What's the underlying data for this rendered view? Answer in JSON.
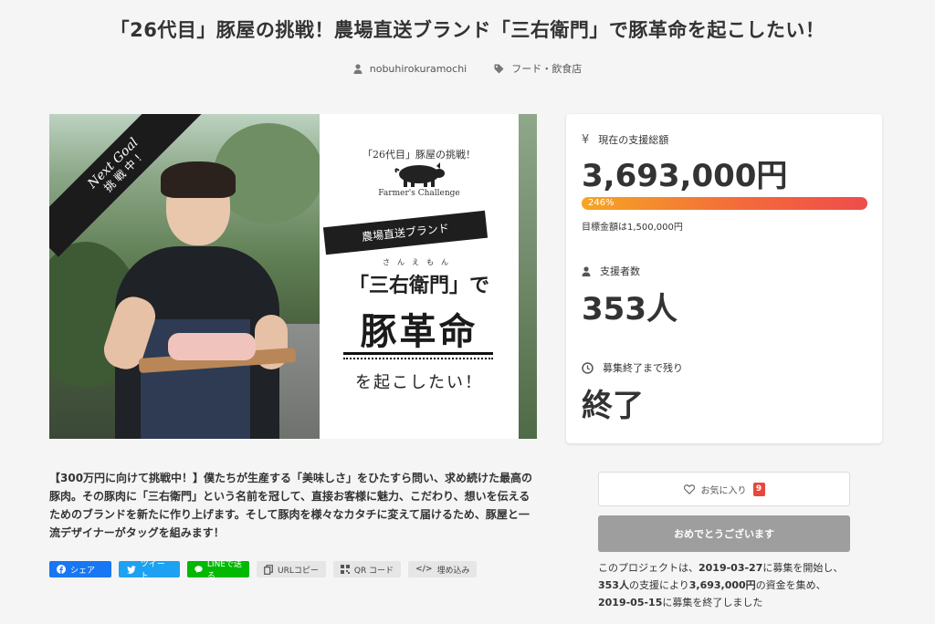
{
  "project": {
    "title": "「26代目」豚屋の挑戦！農場直送ブランド「三右衛門」で豚革命を起こしたい！",
    "author": "nobuhirokuramochi",
    "category": "フード・飲食店"
  },
  "hero": {
    "sash_line1": "Next Goal",
    "sash_line2": "挑 戦 中 !",
    "subtitle": "「26代目」豚屋の挑戦！",
    "farmers": "Farmer's Challenge",
    "ribbon": "農場直送ブランド",
    "ruby": "さんえもん",
    "brand": "「三右衛門」で",
    "big": "豚革命",
    "end": "を起こしたい！"
  },
  "stats": {
    "raised_label": "現在の支援総額",
    "raised_value": "3,693,000円",
    "progress_pct": 246,
    "progress_text": "246%",
    "goal_text": "目標金額は1,500,000円",
    "backers_label": "支援者数",
    "backers_value": "353人",
    "remaining_label": "募集終了まで残り",
    "remaining_value": "終了"
  },
  "description": "【300万円に向けて挑戦中！】僕たちが生産する「美味しさ」をひたすら問い、求め続けた最高の豚肉。その豚肉に「三右衛門」という名前を冠して、直接お客様に魅力、こだわり、想いを伝えるためのブランドを新たに作り上げます。そして豚肉を様々なカタチに変えて届けるため、豚屋と一流デザイナーがタッグを組みます！",
  "share": {
    "facebook": "シェア",
    "twitter": "ツイート",
    "line": "LINEで送る",
    "url_copy": "URLコピー",
    "qr": "QR コード",
    "embed": "埋め込み"
  },
  "actions": {
    "favorite_label": "お気に入り",
    "favorite_count": "9",
    "congrats_label": "おめでとうございます"
  },
  "result": {
    "prefix": "このプロジェクトは、",
    "start_date": "2019-03-27",
    "mid1": "に募集を開始し、",
    "backers": "353人",
    "mid2": "の支援により",
    "amount": "3,693,000円",
    "mid3": "の資金を集め、",
    "end_date": "2019-05-15",
    "suffix": "に募集を終了しました"
  },
  "colors": {
    "progress_start": "#f5a623",
    "progress_end": "#ee4c4c",
    "facebook": "#1877f2",
    "twitter": "#1da1f2",
    "line": "#00b900",
    "badge": "#e8473e"
  }
}
